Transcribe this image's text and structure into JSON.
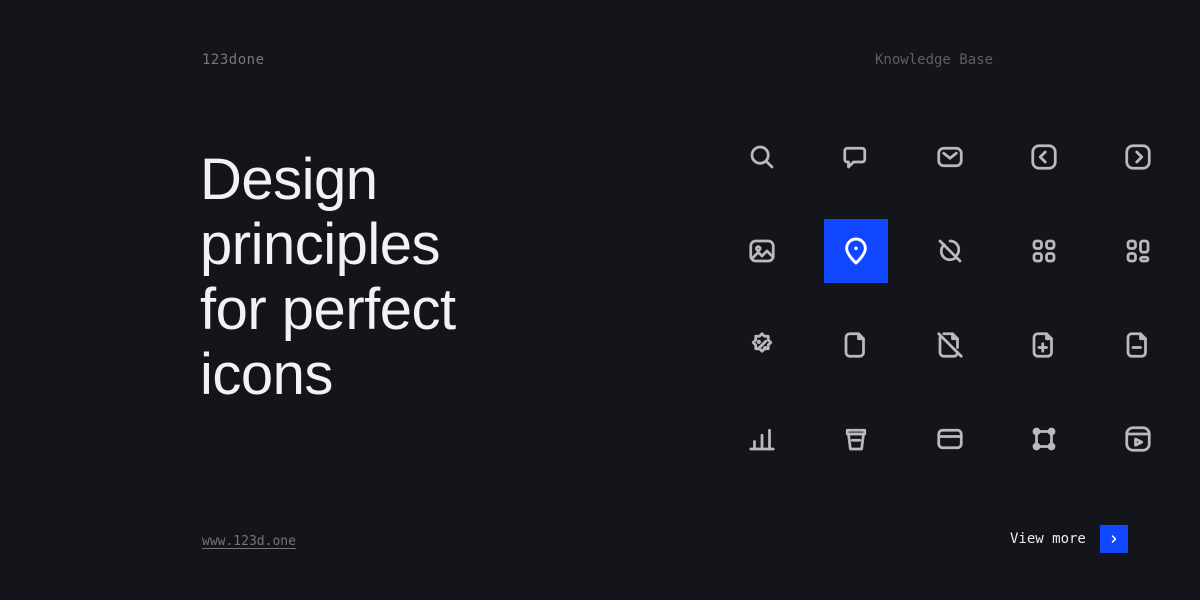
{
  "brand": "123done",
  "section": "Knowledge Base",
  "headline": "Design\nprinciples\nfor perfect\nicons",
  "link_text": "www.123d.one",
  "link_href": "www.123d.one",
  "view_more": "View more",
  "accent": "#1148ff",
  "highlighted_icon": "location-pin-icon",
  "icons": [
    "search-icon",
    "chat-icon",
    "mail-icon",
    "chevron-left-box-icon",
    "chevron-right-box-icon",
    "image-icon",
    "location-pin-icon",
    "tag-off-icon",
    "grid-icon",
    "grid-alt-icon",
    "discount-badge-icon",
    "file-icon",
    "file-off-icon",
    "file-add-icon",
    "file-remove-icon",
    "bar-chart-icon",
    "coffee-cup-icon",
    "credit-card-icon",
    "bounding-box-icon",
    "play-box-icon"
  ]
}
